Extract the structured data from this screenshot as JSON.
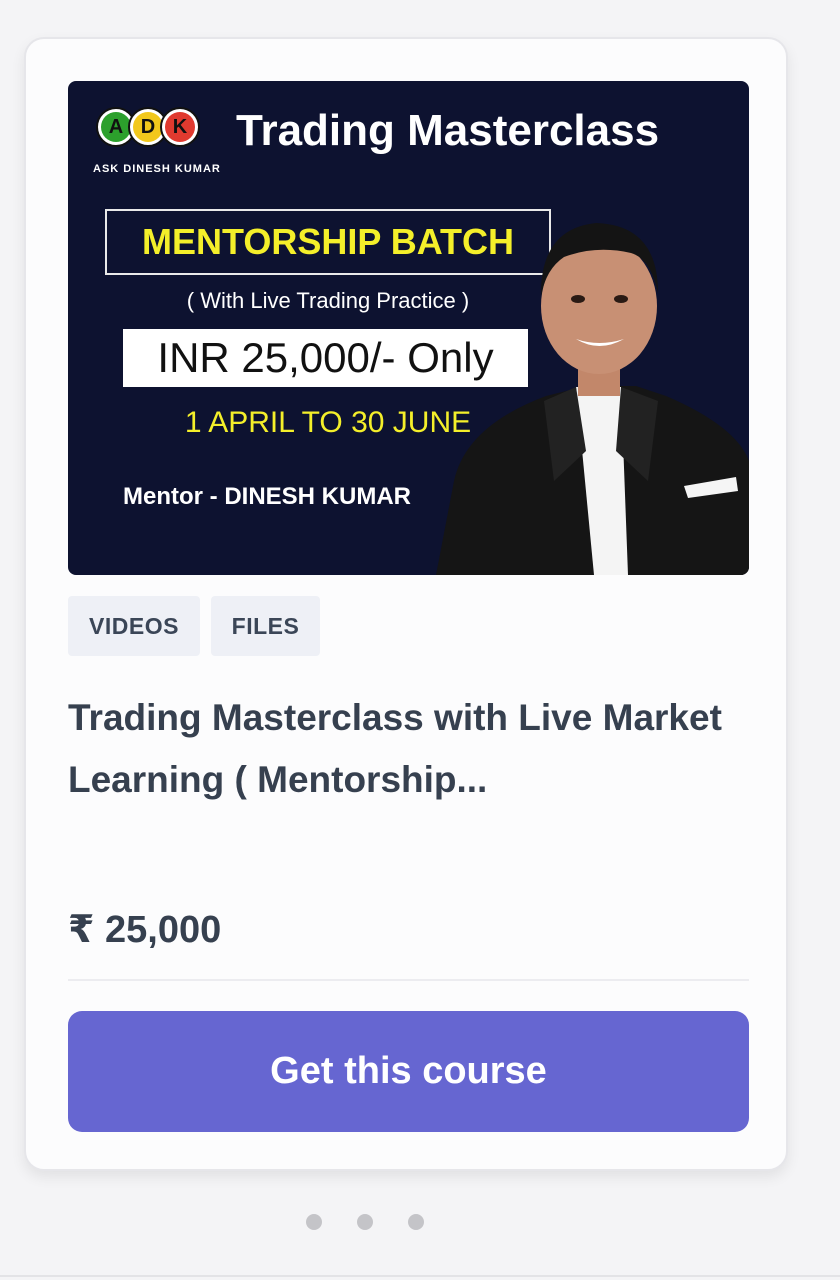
{
  "banner": {
    "logo_letters": [
      "A",
      "D",
      "K"
    ],
    "logo_colors": [
      "#2ca02c",
      "#f2c81c",
      "#e03a2f"
    ],
    "logo_subtitle": "ASK DINESH KUMAR",
    "title": "Trading Masterclass",
    "headline": "MENTORSHIP BATCH",
    "practice": "( With Live Trading Practice )",
    "price": "INR 25,000/- Only",
    "dates": "1 APRIL TO 30 JUNE",
    "mentor": "Mentor - DINESH KUMAR"
  },
  "tags": [
    "VIDEOS",
    "FILES"
  ],
  "course": {
    "title": "Trading Masterclass with Live Market Learning ( Mentorship...",
    "price": "₹ 25,000"
  },
  "cta": {
    "label": "Get this course"
  },
  "carousel": {
    "page_count": 3
  },
  "colors": {
    "accent": "#6666d1",
    "banner_bg": "#0d1230",
    "banner_yellow": "#f4ef2a"
  }
}
